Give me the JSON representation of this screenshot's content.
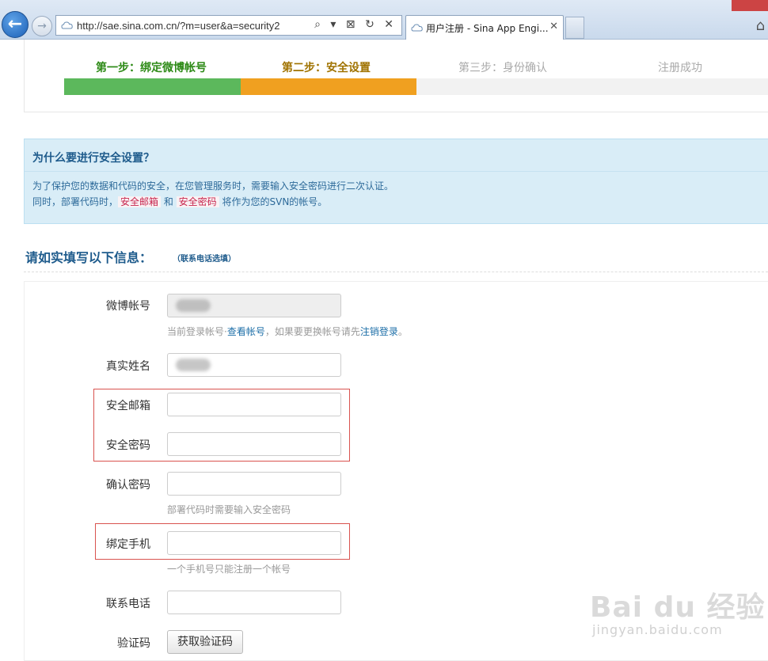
{
  "browser": {
    "url": "http://sae.sina.com.cn/?m=user&a=security2",
    "tab_title": "用户注册 - Sina App Engi...",
    "tools": "⌕ ▾ ⊠ ↻ ✕"
  },
  "steps": [
    {
      "label": "第一步：绑定微博帐号"
    },
    {
      "label": "第二步：安全设置"
    },
    {
      "label": "第三步：身份确认"
    },
    {
      "label": "注册成功"
    }
  ],
  "progress": {
    "completed_fraction": 0.5
  },
  "info": {
    "title": "为什么要进行安全设置？",
    "line1": "为了保护您的数据和代码的安全，在您管理服务时，需要输入安全密码进行二次认证。",
    "line2_pre": "同时，部署代码时，",
    "line2_hl1": "安全邮箱",
    "line2_mid": " 和 ",
    "line2_hl2": "安全密码",
    "line2_post": " 将作为您的SVN的帐号。"
  },
  "form": {
    "title": "请如实填写以下信息：",
    "note": "（联系电话选填）",
    "weibo_label": "微博帐号",
    "weibo_help_pre": "当前登录帐号·",
    "weibo_help_link1": "查看帐号",
    "weibo_help_mid": "，如果要更换帐号请先",
    "weibo_help_link2": "注销登录",
    "weibo_help_post": "。",
    "realname_label": "真实姓名",
    "email_label": "安全邮箱",
    "password_label": "安全密码",
    "confirm_label": "确认密码",
    "confirm_help": "部署代码时需要输入安全密码",
    "phone_label": "绑定手机",
    "phone_help": "一个手机号只能注册一个帐号",
    "contact_label": "联系电话",
    "captcha_label": "验证码",
    "captcha_button": "获取验证码"
  },
  "watermark": {
    "main": "Bai du 经验",
    "sub": "jingyan.baidu.com"
  }
}
